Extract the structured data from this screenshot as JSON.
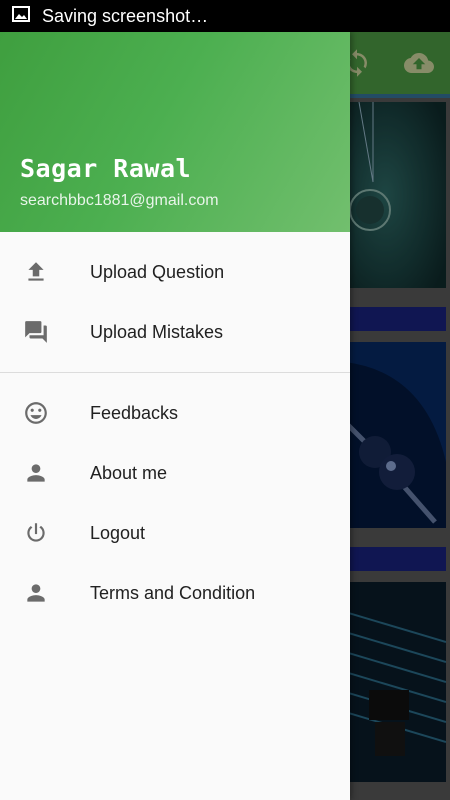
{
  "status_bar": {
    "notification_text": "Saving screenshot…",
    "icon": "image-icon"
  },
  "app_toolbar": {
    "color": "#4e9c44",
    "icons": [
      "sync-icon",
      "cloud-upload-icon"
    ]
  },
  "drawer": {
    "header": {
      "name": "Sagar Rawal",
      "email": "searchbbc1881@gmail.com",
      "gradient_colors": [
        "#3f9f3f",
        "#72bf6e"
      ]
    },
    "primary_items": [
      {
        "label": "Upload Question",
        "icon": "upload-icon"
      },
      {
        "label": "Upload Mistakes",
        "icon": "forum-icon"
      }
    ],
    "secondary_items": [
      {
        "label": "Feedbacks",
        "icon": "smiley-icon"
      },
      {
        "label": "About me",
        "icon": "person-icon"
      },
      {
        "label": "Logout",
        "icon": "power-icon"
      },
      {
        "label": "Terms and Condition",
        "icon": "person-icon"
      }
    ]
  }
}
